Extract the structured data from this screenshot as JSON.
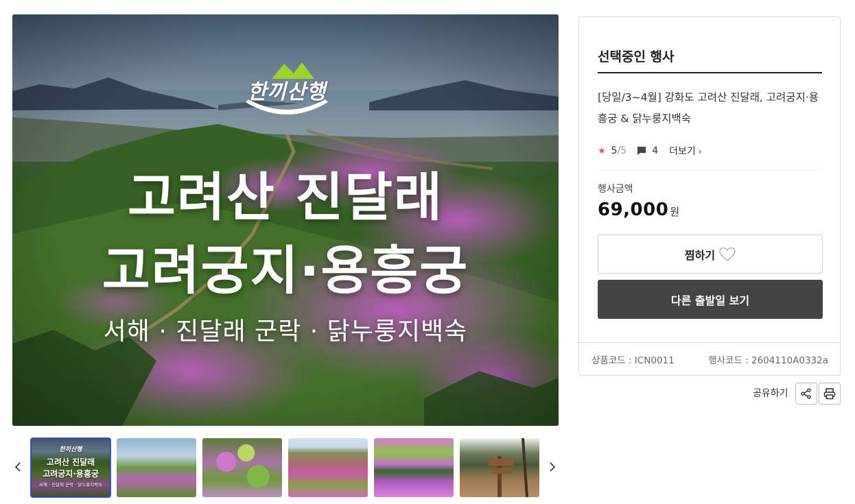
{
  "hero": {
    "logo_text": "한끼산행",
    "title_line1": "고려산 진달래",
    "title_line2": "고려궁지·용흥궁",
    "subtitle": "서해 · 진달래 군락 · 닭누룽지백숙"
  },
  "thumbnails": {
    "prev_icon": "chevron-left-icon",
    "next_icon": "chevron-right-icon",
    "items": [
      {
        "active": true,
        "logo": "한끼산행",
        "line1": "고려산 진달래",
        "line2": "고려궁지·용흥궁",
        "line3": "서해 · 진달래 군락 · 닭누룽지백숙"
      },
      {
        "active": false
      },
      {
        "active": false
      },
      {
        "active": false
      },
      {
        "active": false
      },
      {
        "active": false
      }
    ]
  },
  "panel": {
    "title": "선택중인 행사",
    "product_name": "[당일/3~4월] 강화도 고려산 진달래, 고려궁지·용흥궁 & 닭누룽지백숙",
    "rating_score": "5",
    "rating_total": "/5",
    "comment_count": "4",
    "more_label": "더보기",
    "price_label": "행사금액",
    "price_value": "69,000",
    "price_unit": "원",
    "wish_label": "찜하기",
    "other_dates_label": "다른 출발일 보기",
    "product_code": "상품코드 : ICN0011",
    "event_code": "행사코드 : 2604110A0332a"
  },
  "share": {
    "label": "공유하기",
    "share_icon": "share-icon",
    "print_icon": "print-icon"
  },
  "colors": {
    "accent_star": "#e8505b",
    "dark_button": "#444444",
    "thumb_active": "#3b5bd6"
  }
}
